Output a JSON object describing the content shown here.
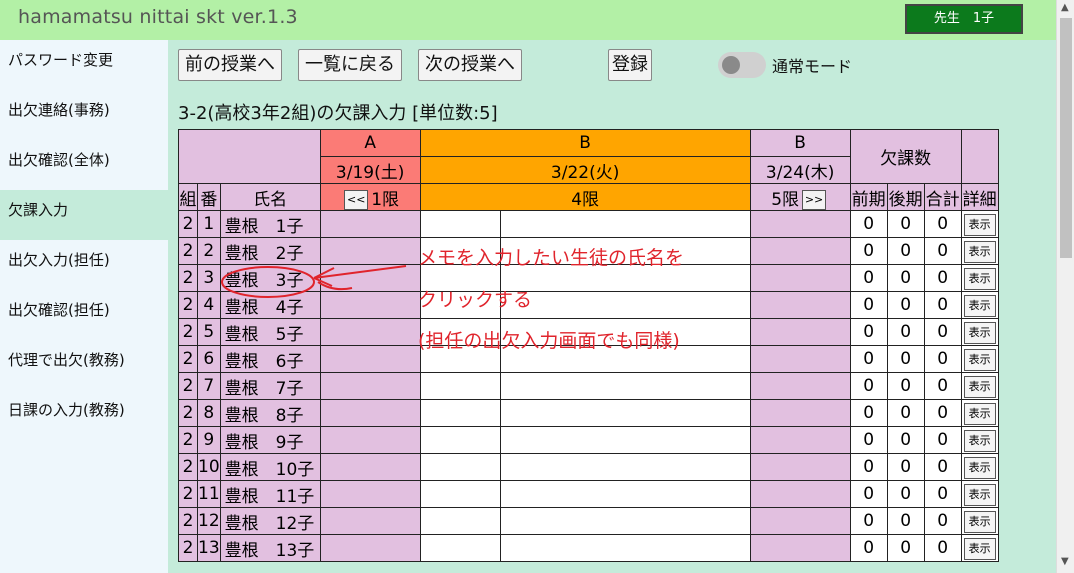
{
  "app": {
    "title": "hamamatsu nittai skt ver.1.3",
    "user": "先生　1子"
  },
  "sidebar": {
    "items": [
      {
        "label": "パスワード変更",
        "active": false
      },
      {
        "label": "出欠連絡(事務)",
        "active": false
      },
      {
        "label": "出欠確認(全体)",
        "active": false
      },
      {
        "label": "欠課入力",
        "active": true
      },
      {
        "label": "出欠入力(担任)",
        "active": false
      },
      {
        "label": "出欠確認(担任)",
        "active": false
      },
      {
        "label": "代理で出欠(教務)",
        "active": false
      },
      {
        "label": "日課の入力(教務)",
        "active": false
      }
    ]
  },
  "toolbar": {
    "prev": "前の授業へ",
    "back": "一覧に戻る",
    "next": "次の授業へ",
    "register": "登録",
    "mode": "通常モード"
  },
  "section_title": "3-2(高校3年2組)の欠課入力 [単位数:5]",
  "table": {
    "weeks": [
      "A",
      "B",
      "B"
    ],
    "dates": [
      "3/19(土)",
      "3/22(火)",
      "3/24(木)"
    ],
    "periods": [
      "1限",
      "4限",
      "5限"
    ],
    "nav_prev": "<<",
    "nav_next": ">>",
    "absences_header": "欠課数",
    "col_class": "組",
    "col_num": "番",
    "col_name": "氏名",
    "col_first": "前期",
    "col_second": "後期",
    "col_total": "合計",
    "col_detail": "詳細",
    "show_label": "表示",
    "rows": [
      {
        "cls": "2",
        "num": "1",
        "name": "豊根　1子",
        "first": "0",
        "second": "0",
        "total": "0"
      },
      {
        "cls": "2",
        "num": "2",
        "name": "豊根　2子",
        "first": "0",
        "second": "0",
        "total": "0"
      },
      {
        "cls": "2",
        "num": "3",
        "name": "豊根　3子",
        "first": "0",
        "second": "0",
        "total": "0"
      },
      {
        "cls": "2",
        "num": "4",
        "name": "豊根　4子",
        "first": "0",
        "second": "0",
        "total": "0"
      },
      {
        "cls": "2",
        "num": "5",
        "name": "豊根　5子",
        "first": "0",
        "second": "0",
        "total": "0"
      },
      {
        "cls": "2",
        "num": "6",
        "name": "豊根　6子",
        "first": "0",
        "second": "0",
        "total": "0"
      },
      {
        "cls": "2",
        "num": "7",
        "name": "豊根　7子",
        "first": "0",
        "second": "0",
        "total": "0"
      },
      {
        "cls": "2",
        "num": "8",
        "name": "豊根　8子",
        "first": "0",
        "second": "0",
        "total": "0"
      },
      {
        "cls": "2",
        "num": "9",
        "name": "豊根　9子",
        "first": "0",
        "second": "0",
        "total": "0"
      },
      {
        "cls": "2",
        "num": "10",
        "name": "豊根　10子",
        "first": "0",
        "second": "0",
        "total": "0"
      },
      {
        "cls": "2",
        "num": "11",
        "name": "豊根　11子",
        "first": "0",
        "second": "0",
        "total": "0"
      },
      {
        "cls": "2",
        "num": "12",
        "name": "豊根　12子",
        "first": "0",
        "second": "0",
        "total": "0"
      },
      {
        "cls": "2",
        "num": "13",
        "name": "豊根　13子",
        "first": "0",
        "second": "0",
        "total": "0"
      }
    ]
  },
  "annotation": {
    "line1": "メモを入力したい生徒の氏名を",
    "line2": "クリックする",
    "line3": "(担任の出欠入力画面でも同様)"
  },
  "colors": {
    "accent_red": "#fb7b76",
    "accent_orange": "#ffa500",
    "pink": "#e2c0e0",
    "annotation": "#e0242c",
    "badge": "#0c7a1c"
  }
}
